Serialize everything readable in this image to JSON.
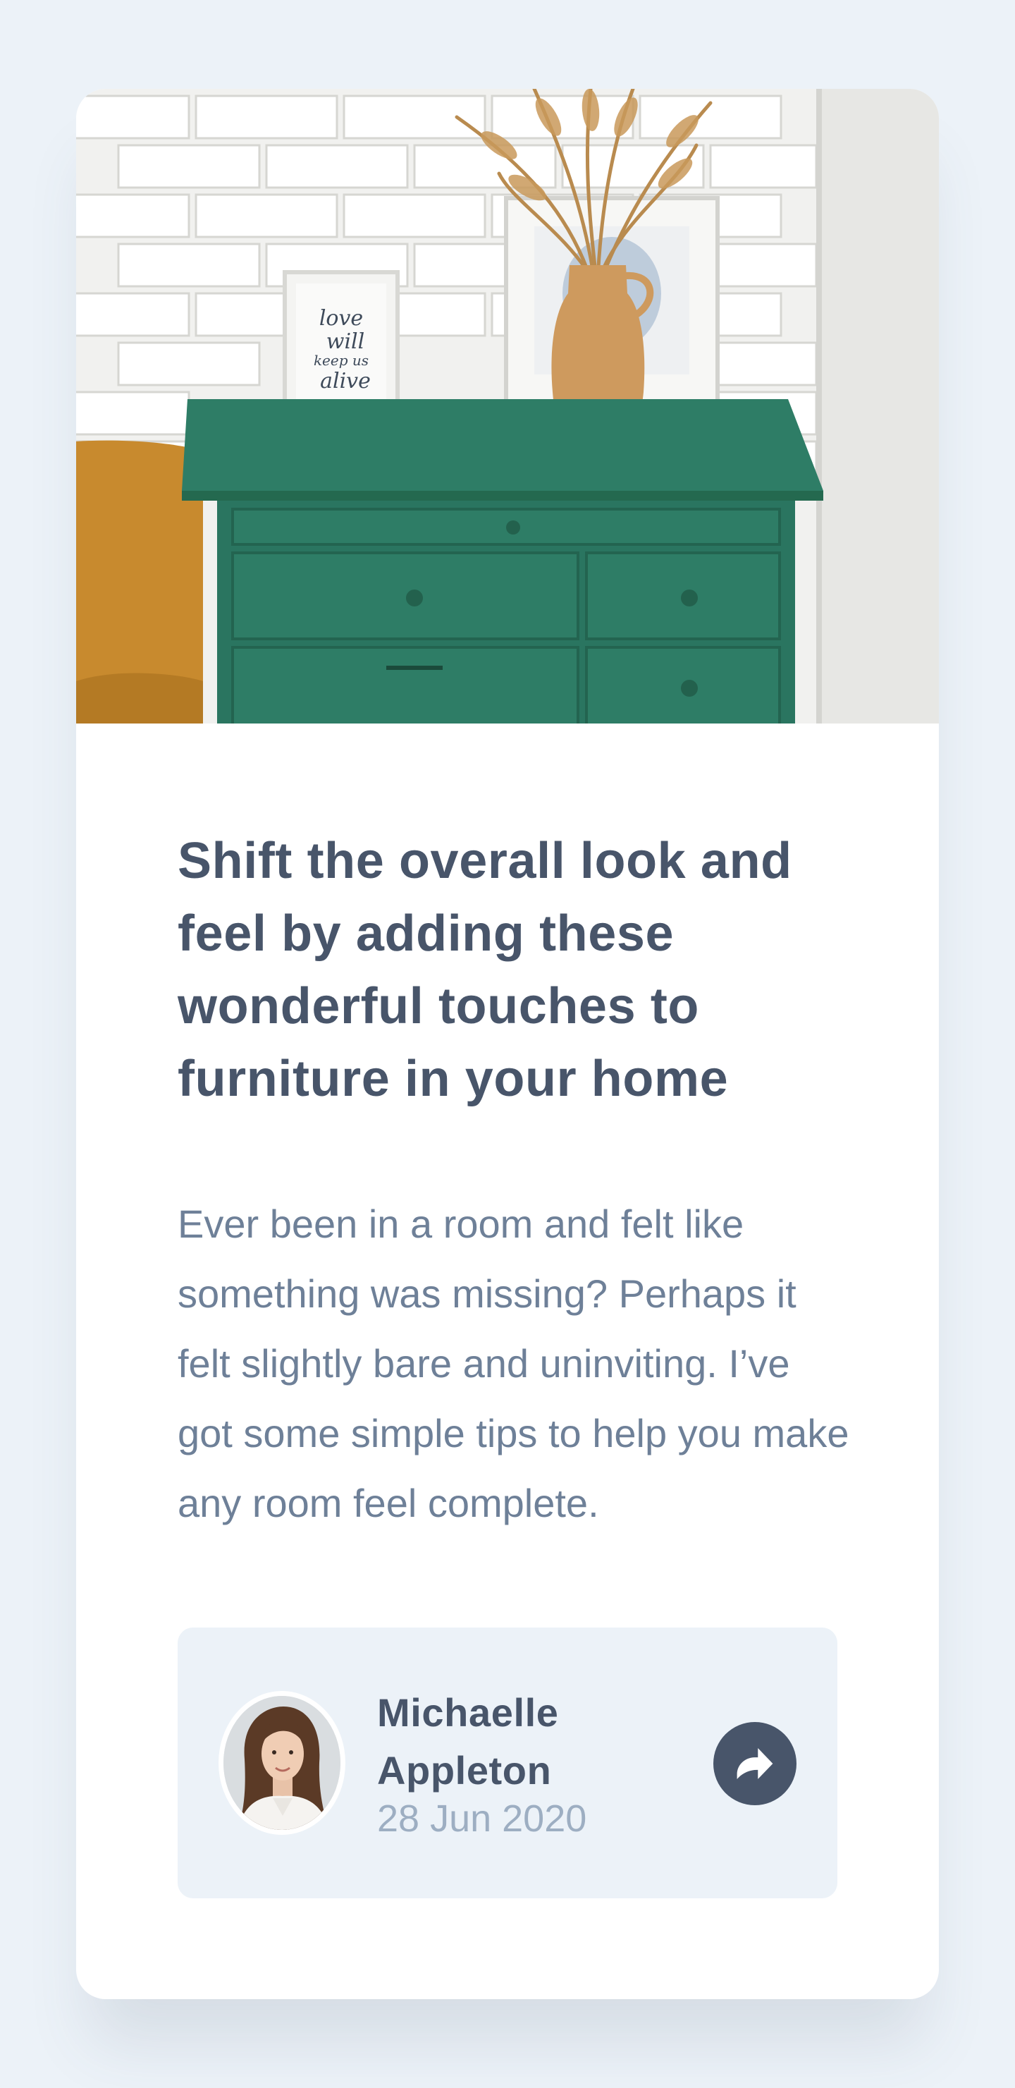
{
  "article": {
    "headline": "Shift the overall look and feel by adding these wonderful touches to furniture in your home",
    "excerpt": "Ever been in a room and felt like something was missing? Perhaps it felt slightly bare and uninviting. I’ve got some simple tips to help you make any room feel complete.",
    "hero_frame_text": "love will keep us alive"
  },
  "author": {
    "name": "Michaelle Appleton",
    "date": "28 Jun 2020"
  },
  "icons": {
    "share": "share-icon"
  },
  "colors": {
    "page_background": "#ECF2F8",
    "card_background": "#FFFFFF",
    "headline": "#48556A",
    "body_text": "#6E8098",
    "date_text": "#9DAEC2",
    "author_bar": "#ECF2F8",
    "share_button": "#48556A",
    "drawer_green": "#2E7D66"
  }
}
